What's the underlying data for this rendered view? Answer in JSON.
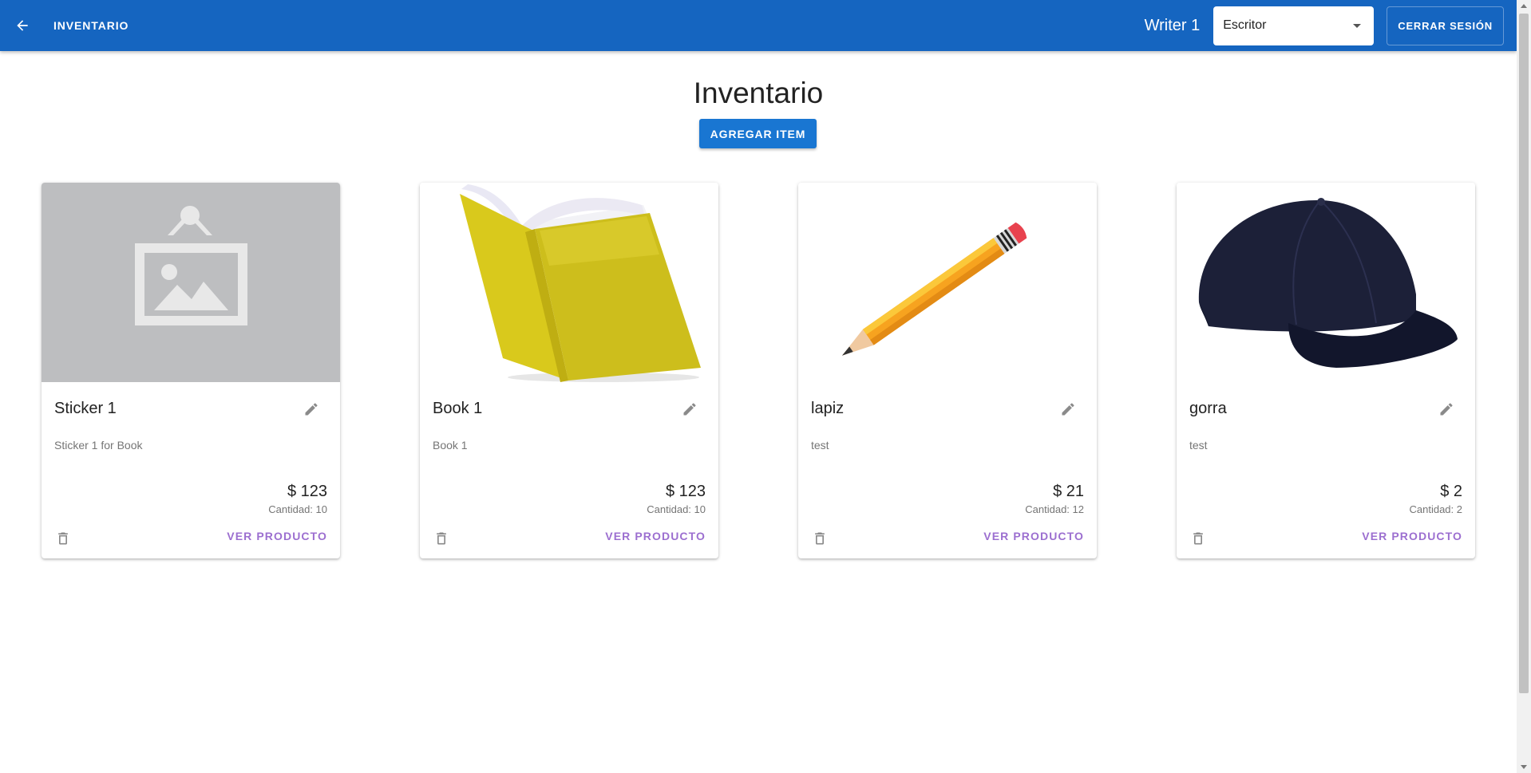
{
  "appbar": {
    "title": "INVENTARIO",
    "user_name": "Writer 1",
    "role_select": {
      "selected": "Escritor"
    },
    "logout_label": "CERRAR SESIÓN",
    "color": "#1565c0"
  },
  "main": {
    "title": "Inventario",
    "add_button_label": "AGREGAR ITEM"
  },
  "products": [
    {
      "name": "Sticker 1",
      "description": "Sticker 1 for Book",
      "price": "$ 123",
      "quantity": "Cantidad: 10",
      "view_label": "VER PRODUCTO",
      "image": "placeholder-image-icon"
    },
    {
      "name": "Book 1",
      "description": "Book 1",
      "price": "$ 123",
      "quantity": "Cantidad: 10",
      "view_label": "VER PRODUCTO",
      "image": "yellow-book"
    },
    {
      "name": "lapiz",
      "description": "test",
      "price": "$ 21",
      "quantity": "Cantidad: 12",
      "view_label": "VER PRODUCTO",
      "image": "pencil"
    },
    {
      "name": "gorra",
      "description": "test",
      "price": "$ 2",
      "quantity": "Cantidad: 2",
      "view_label": "VER PRODUCTO",
      "image": "navy-cap"
    }
  ],
  "icons": {
    "back": "arrow-left-icon",
    "edit": "pencil-icon",
    "delete": "trash-icon"
  },
  "accent_colors": {
    "primary": "#1976d2",
    "link": "#9c6fd0"
  }
}
